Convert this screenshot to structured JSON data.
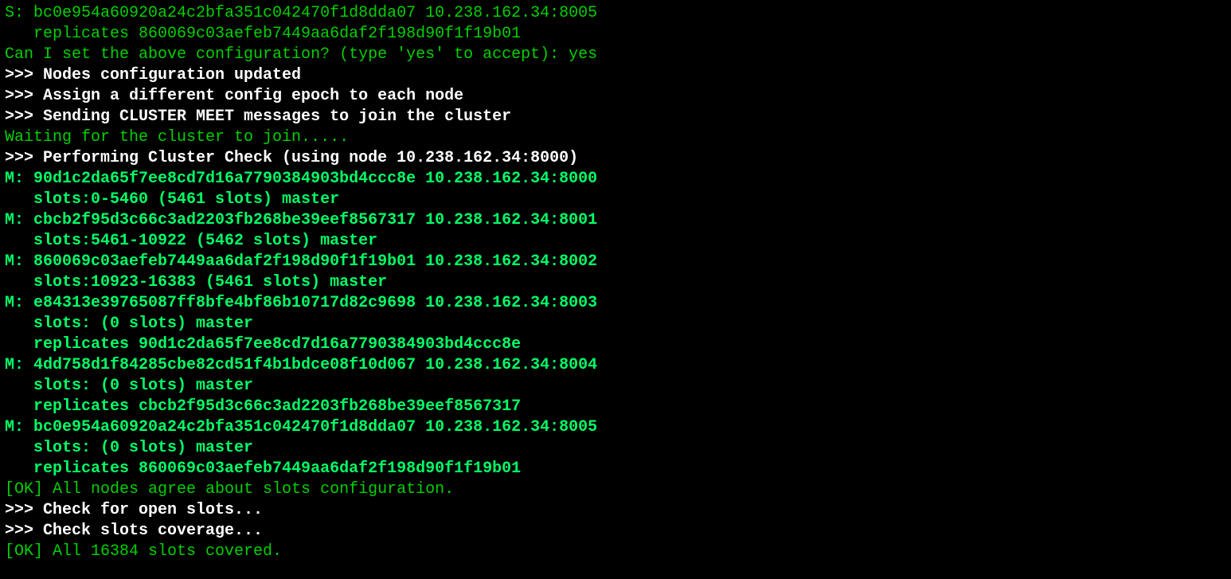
{
  "lines": [
    {
      "cls": "g",
      "text": "S: bc0e954a60920a24c2bfa351c042470f1d8dda07 10.238.162.34:8005"
    },
    {
      "cls": "g",
      "text": "   replicates 860069c03aefeb7449aa6daf2f198d90f1f19b01"
    },
    {
      "cls": "g",
      "text": "Can I set the above configuration? (type 'yes' to accept): yes"
    },
    {
      "cls": "wb",
      "text": ">>> Nodes configuration updated"
    },
    {
      "cls": "wb",
      "text": ">>> Assign a different config epoch to each node"
    },
    {
      "cls": "wb",
      "text": ">>> Sending CLUSTER MEET messages to join the cluster"
    },
    {
      "cls": "g",
      "text": "Waiting for the cluster to join....."
    },
    {
      "cls": "wb",
      "text": ">>> Performing Cluster Check (using node 10.238.162.34:8000)"
    },
    {
      "cls": "gb",
      "text": "M: 90d1c2da65f7ee8cd7d16a7790384903bd4ccc8e 10.238.162.34:8000"
    },
    {
      "cls": "gb",
      "text": "   slots:0-5460 (5461 slots) master"
    },
    {
      "cls": "gb",
      "text": "M: cbcb2f95d3c66c3ad2203fb268be39eef8567317 10.238.162.34:8001"
    },
    {
      "cls": "gb",
      "text": "   slots:5461-10922 (5462 slots) master"
    },
    {
      "cls": "gb",
      "text": "M: 860069c03aefeb7449aa6daf2f198d90f1f19b01 10.238.162.34:8002"
    },
    {
      "cls": "gb",
      "text": "   slots:10923-16383 (5461 slots) master"
    },
    {
      "cls": "gb",
      "text": "M: e84313e39765087ff8bfe4bf86b10717d82c9698 10.238.162.34:8003"
    },
    {
      "cls": "gb",
      "text": "   slots: (0 slots) master"
    },
    {
      "cls": "gb",
      "text": "   replicates 90d1c2da65f7ee8cd7d16a7790384903bd4ccc8e"
    },
    {
      "cls": "gb",
      "text": "M: 4dd758d1f84285cbe82cd51f4b1bdce08f10d067 10.238.162.34:8004"
    },
    {
      "cls": "gb",
      "text": "   slots: (0 slots) master"
    },
    {
      "cls": "gb",
      "text": "   replicates cbcb2f95d3c66c3ad2203fb268be39eef8567317"
    },
    {
      "cls": "gb",
      "text": "M: bc0e954a60920a24c2bfa351c042470f1d8dda07 10.238.162.34:8005"
    },
    {
      "cls": "gb",
      "text": "   slots: (0 slots) master"
    },
    {
      "cls": "gb",
      "text": "   replicates 860069c03aefeb7449aa6daf2f198d90f1f19b01"
    },
    {
      "cls": "g",
      "text": "[OK] All nodes agree about slots configuration."
    },
    {
      "cls": "wb",
      "text": ">>> Check for open slots..."
    },
    {
      "cls": "wb",
      "text": ">>> Check slots coverage..."
    },
    {
      "cls": "g",
      "text": "[OK] All 16384 slots covered."
    }
  ]
}
